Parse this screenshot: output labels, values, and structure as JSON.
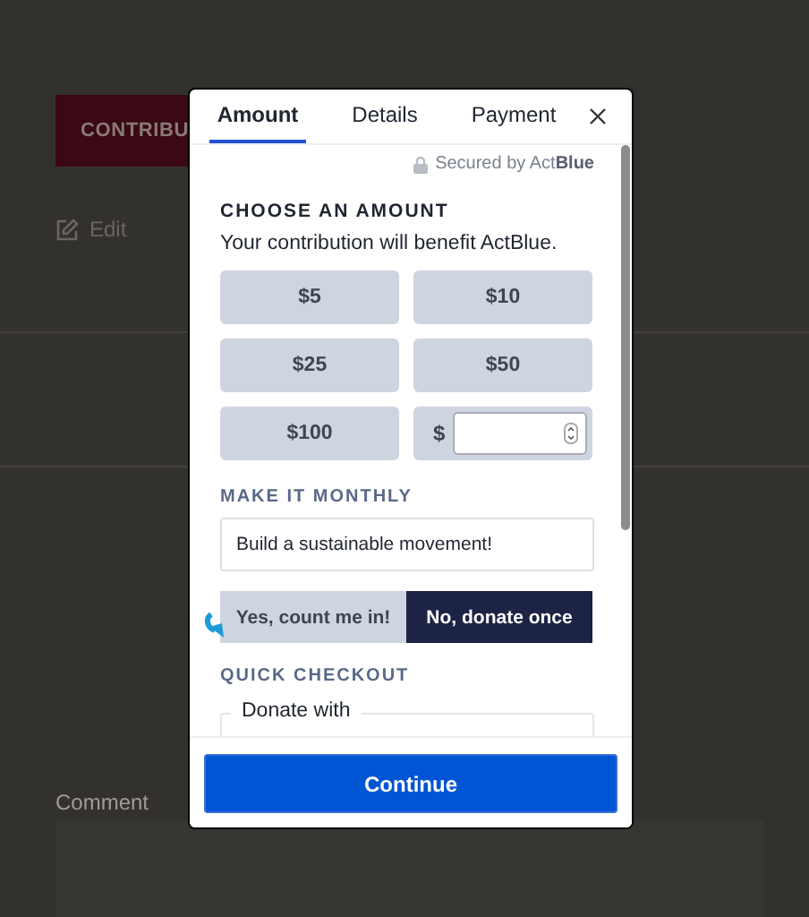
{
  "page": {
    "contribute_button": "CONTRIBU",
    "edit_link": "Edit",
    "comment_label": "Comment"
  },
  "modal": {
    "tabs": [
      {
        "label": "Amount",
        "selected": true
      },
      {
        "label": "Details",
        "selected": false
      },
      {
        "label": "Payment",
        "selected": false
      }
    ],
    "secured": "Secured by Act**Blue**",
    "heading": "CHOOSE AN AMOUNT",
    "subtitle": "Your contribution will benefit ActBlue.",
    "amounts": [
      {
        "label": "$5",
        "selected": false
      },
      {
        "label": "$10",
        "selected": false
      },
      {
        "label": "$25",
        "selected": false
      },
      {
        "label": "$50",
        "selected": false
      },
      {
        "label": "$100",
        "selected": false
      }
    ],
    "custom_prefix": "$",
    "monthly_heading": "MAKE IT MONTHLY",
    "monthly_message": "Build a sustainable movement!",
    "monthly_options": [
      {
        "label": "Yes, count me in!",
        "selected": false
      },
      {
        "label": "No, donate once",
        "selected": true
      }
    ],
    "quick_heading": "QUICK CHECKOUT",
    "quick_legend": "Donate with",
    "continue": "Continue"
  }
}
